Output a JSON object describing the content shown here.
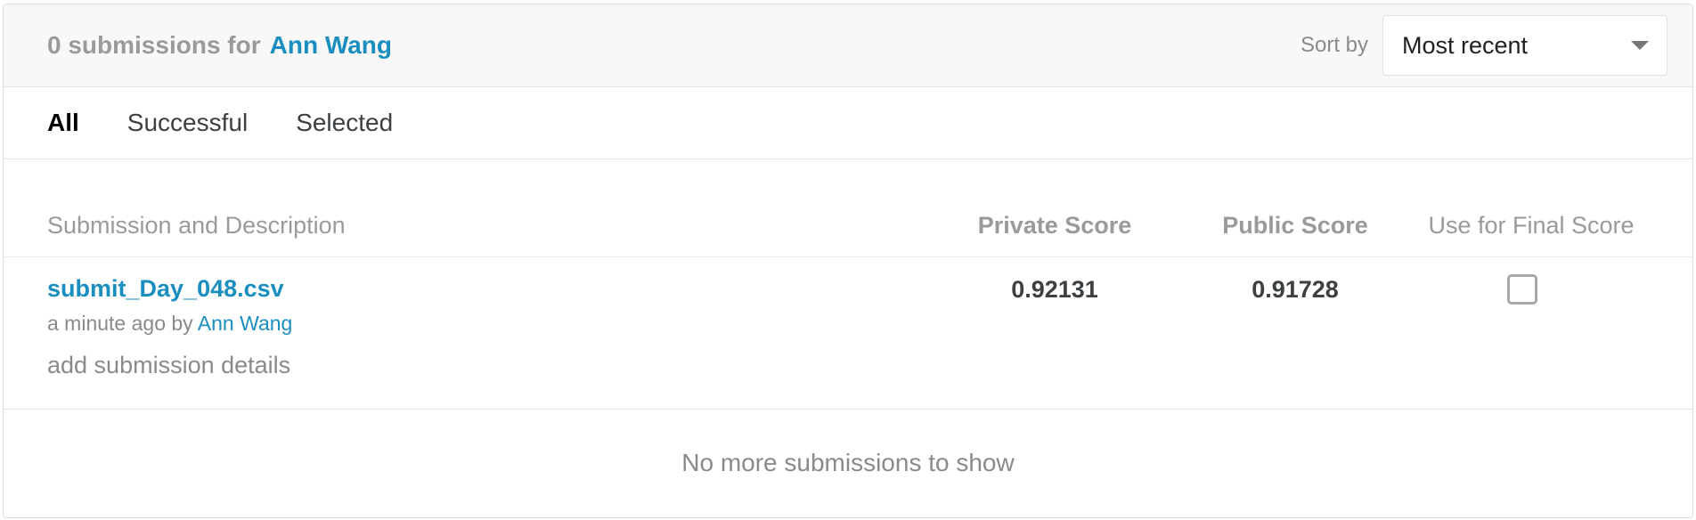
{
  "header": {
    "count_text": "0 submissions for",
    "user_name": "Ann Wang",
    "sort_label": "Sort by",
    "sort_selected": "Most recent"
  },
  "tabs": [
    {
      "label": "All",
      "active": true
    },
    {
      "label": "Successful",
      "active": false
    },
    {
      "label": "Selected",
      "active": false
    }
  ],
  "table": {
    "columns": {
      "description": "Submission and Description",
      "private_score": "Private Score",
      "public_score": "Public Score",
      "use_final": "Use for Final Score"
    },
    "rows": [
      {
        "file_name": "submit_Day_048.csv",
        "time_text": "a minute ago by",
        "user": "Ann Wang",
        "details_link": "add submission details",
        "private_score": "0.92131",
        "public_score": "0.91728",
        "use_for_final": false
      }
    ]
  },
  "footer": {
    "message": "No more submissions to show"
  },
  "colors": {
    "link": "#1a8fbf",
    "muted": "#9a9a9a",
    "header_bg": "#f8f8f8"
  },
  "icons": {
    "sort_dropdown": "chevron-down-icon"
  }
}
